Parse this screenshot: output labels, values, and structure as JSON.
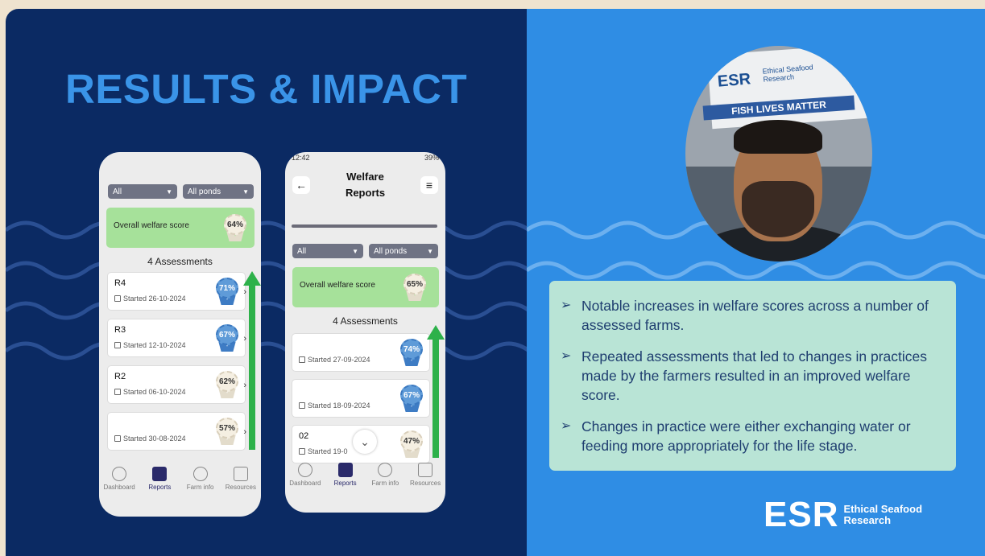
{
  "title": "RESULTS & IMPACT",
  "phone1": {
    "filters": [
      "All",
      "All ponds"
    ],
    "overall_label": "Overall welfare score",
    "overall_score": "64%",
    "assessments_count": "4 Assessments",
    "cards": [
      {
        "code": "R4",
        "date": "Started 26-10-2024",
        "score": "71%"
      },
      {
        "code": "R3",
        "date": "Started 12-10-2024",
        "score": "67%"
      },
      {
        "code": "R2",
        "date": "Started 06-10-2024",
        "score": "62%"
      },
      {
        "code": "",
        "date": "Started 30-08-2024",
        "score": "57%"
      }
    ]
  },
  "phone2": {
    "status_time": "12:42",
    "status_battery": "39%",
    "header_title_line1": "Welfare",
    "header_title_line2": "Reports",
    "filters": [
      "All",
      "All ponds"
    ],
    "overall_label": "Overall welfare score",
    "overall_score": "65%",
    "assessments_count": "4 Assessments",
    "cards": [
      {
        "code": "",
        "date": "Started 27-09-2024",
        "score": "74%"
      },
      {
        "code": "",
        "date": "Started 18-09-2024",
        "score": "67%"
      },
      {
        "code": "02",
        "date": "Started 19-0",
        "score": "47%"
      }
    ]
  },
  "tabs": [
    "Dashboard",
    "Reports",
    "Farm info",
    "Resources"
  ],
  "video": {
    "banner_logo": "ESR",
    "banner_sub_1": "Ethical Seafood",
    "banner_sub_2": "Research",
    "banner_strip": "FISH LIVES MATTER"
  },
  "bullets": [
    "Notable increases in welfare scores across a number of assessed farms.",
    "Repeated assessments that led to changes in practices made by the farmers resulted in an improved welfare score.",
    "Changes in practice were either exchanging water or feeding more appropriately for the life stage."
  ],
  "logo": {
    "mark": "ESR",
    "line1": "Ethical Seafood",
    "line2": "Research"
  },
  "colors": {
    "left_bg": "#0b2a63",
    "right_bg": "#2f8de4",
    "title": "#3a94e8",
    "score_green": "#a6e19a",
    "arrow": "#2db14a"
  }
}
